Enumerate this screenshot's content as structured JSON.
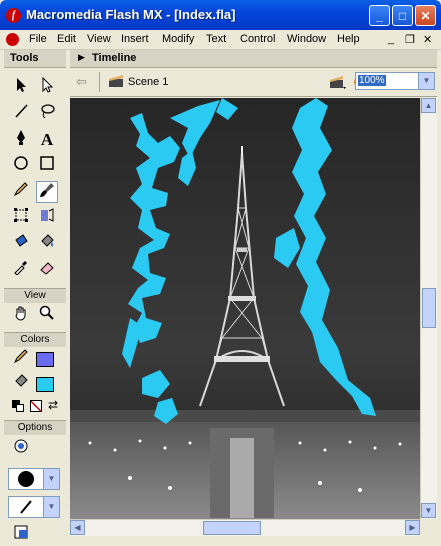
{
  "window": {
    "title": "Macromedia Flash MX - [Index.fla]",
    "app_icon_letter": "f",
    "controls": {
      "minimize": "_",
      "maximize": "□",
      "close": "✕"
    }
  },
  "menubar": {
    "items": [
      "File",
      "Edit",
      "View",
      "Insert",
      "Modify",
      "Text",
      "Control",
      "Window",
      "Help"
    ],
    "doc_controls": {
      "minimize": "_",
      "restore": "❐",
      "close": "✕"
    }
  },
  "tools_panel": {
    "title": "Tools",
    "view_label": "View",
    "colors_label": "Colors",
    "options_label": "Options",
    "stroke_color": "#000000",
    "fill_color": "#2bcaf2",
    "stroke_swatch_color": "#6b6bf0",
    "icons": [
      "arrow-tool-icon",
      "subselect-tool-icon",
      "line-tool-icon",
      "lasso-tool-icon",
      "pen-tool-icon",
      "text-tool-icon",
      "oval-tool-icon",
      "rectangle-tool-icon",
      "pencil-tool-icon",
      "brush-tool-icon",
      "free-transform-tool-icon",
      "fill-transform-tool-icon",
      "ink-bottle-tool-icon",
      "paint-bucket-tool-icon",
      "eyedropper-tool-icon",
      "eraser-tool-icon",
      "hand-tool-icon",
      "zoom-tool-icon"
    ]
  },
  "timeline": {
    "title": "Timeline"
  },
  "edit_bar": {
    "scene_label": "Scene 1",
    "zoom_value": "100%"
  },
  "stage": {
    "background_color": "#2b2b2b",
    "brush_color": "#2bcaf2"
  }
}
